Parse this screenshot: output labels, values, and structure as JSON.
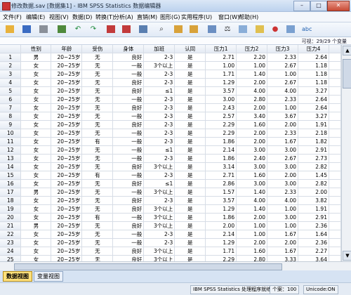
{
  "window": {
    "title": "修改数据.sav [数据集1] - IBM SPSS Statistics 数据编辑器"
  },
  "menu": [
    "文件(F)",
    "编辑(E)",
    "视图(V)",
    "数据(D)",
    "转换(T)",
    "分析(A)",
    "直销(M)",
    "图形(G)",
    "实用程序(U)",
    "窗口(W)",
    "帮助(H)"
  ],
  "toolbar_icons": [
    "open-icon",
    "save-icon",
    "print-icon",
    "dialog-recall-icon",
    "undo-icon",
    "redo-icon",
    "goto-case-icon",
    "goto-variable-icon",
    "variables-icon",
    "find-icon",
    "insert-case-icon",
    "insert-variable-icon",
    "split-file-icon",
    "weight-cases-icon",
    "select-cases-icon",
    "value-labels-icon",
    "use-sets-icon",
    "show-all-icon",
    "spell-check-icon"
  ],
  "visible_label": "可视：29/29 个变量",
  "columns": [
    "性别",
    "年龄",
    "受伤",
    "身体",
    "加班",
    "认同",
    "压力1",
    "压力2",
    "压力3",
    "压力4"
  ],
  "rows": [
    [
      "男",
      "20~25岁",
      "无",
      "良好",
      "2-3",
      "是",
      "2.71",
      "2.20",
      "2.33",
      "2.64"
    ],
    [
      "女",
      "20~25岁",
      "无",
      "一般",
      "3个以上",
      "是",
      "1.00",
      "1.00",
      "2.67",
      "1.18"
    ],
    [
      "女",
      "20~25岁",
      "无",
      "一般",
      "2-3",
      "是",
      "1.71",
      "1.40",
      "1.00",
      "1.18"
    ],
    [
      "女",
      "20~25岁",
      "无",
      "良好",
      "2-3",
      "是",
      "1.29",
      "2.00",
      "2.67",
      "1.18"
    ],
    [
      "女",
      "20~25岁",
      "无",
      "良好",
      "≤1",
      "是",
      "3.57",
      "4.00",
      "4.00",
      "3.27"
    ],
    [
      "女",
      "20~25岁",
      "无",
      "一般",
      "2-3",
      "是",
      "3.00",
      "2.80",
      "2.33",
      "2.64"
    ],
    [
      "女",
      "20~25岁",
      "无",
      "良好",
      "2-3",
      "是",
      "2.43",
      "2.00",
      "1.00",
      "2.64"
    ],
    [
      "女",
      "20~25岁",
      "无",
      "一般",
      "2-3",
      "是",
      "2.57",
      "3.40",
      "3.67",
      "3.27"
    ],
    [
      "女",
      "20~25岁",
      "无",
      "良好",
      "2-3",
      "是",
      "2.29",
      "1.60",
      "2.00",
      "1.91"
    ],
    [
      "女",
      "20~25岁",
      "无",
      "一般",
      "2-3",
      "是",
      "2.29",
      "2.00",
      "2.33",
      "2.18"
    ],
    [
      "女",
      "20~25岁",
      "有",
      "一般",
      "2-3",
      "是",
      "1.86",
      "2.00",
      "1.67",
      "1.82"
    ],
    [
      "女",
      "20~25岁",
      "无",
      "一般",
      "≤1",
      "是",
      "2.14",
      "3.00",
      "3.00",
      "2.91"
    ],
    [
      "女",
      "20~25岁",
      "无",
      "一般",
      "2-3",
      "是",
      "1.86",
      "2.40",
      "2.67",
      "2.73"
    ],
    [
      "女",
      "20~25岁",
      "无",
      "良好",
      "3个以上",
      "是",
      "3.14",
      "3.00",
      "3.00",
      "2.82"
    ],
    [
      "女",
      "20~25岁",
      "有",
      "一般",
      "2-3",
      "是",
      "2.71",
      "1.60",
      "2.00",
      "1.45"
    ],
    [
      "女",
      "20~25岁",
      "无",
      "良好",
      "≤1",
      "是",
      "2.86",
      "3.00",
      "3.00",
      "2.82"
    ],
    [
      "男",
      "20~25岁",
      "无",
      "一般",
      "3个以上",
      "是",
      "1.57",
      "1.40",
      "2.33",
      "2.00"
    ],
    [
      "女",
      "20~25岁",
      "无",
      "良好",
      "2-3",
      "是",
      "3.57",
      "4.00",
      "4.00",
      "3.82"
    ],
    [
      "女",
      "20~25岁",
      "无",
      "良好",
      "3个以上",
      "是",
      "1.29",
      "1.40",
      "1.00",
      "1.91"
    ],
    [
      "女",
      "20~25岁",
      "有",
      "一般",
      "3个以上",
      "是",
      "1.86",
      "2.00",
      "3.00",
      "2.91"
    ],
    [
      "男",
      "20~25岁",
      "无",
      "良好",
      "3个以上",
      "是",
      "2.00",
      "1.00",
      "1.00",
      "2.36"
    ],
    [
      "女",
      "20~25岁",
      "无",
      "一般",
      "2-3",
      "是",
      "2.14",
      "1.00",
      "1.67",
      "1.64"
    ],
    [
      "女",
      "20~25岁",
      "无",
      "一般",
      "2-3",
      "是",
      "1.29",
      "2.00",
      "2.00",
      "2.36"
    ],
    [
      "女",
      "20~25岁",
      "无",
      "良好",
      "3个以上",
      "是",
      "1.71",
      "1.60",
      "1.67",
      "2.27"
    ],
    [
      "女",
      "20~25岁",
      "无",
      "良好",
      "3个以上",
      "是",
      "2.29",
      "2.80",
      "3.33",
      "3.64"
    ],
    [
      "女",
      "20~25岁",
      "无",
      "一般",
      "3个以上",
      "是",
      "1.86",
      "2.20",
      "2.33",
      "2.45"
    ]
  ],
  "tabs": {
    "data_view": "数据视图",
    "variable_view": "变量视图"
  },
  "status": {
    "processor": "IBM SPSS Statistics 处理程序就绪",
    "cases": "个案：100",
    "unicode": "Unicode:ON"
  }
}
